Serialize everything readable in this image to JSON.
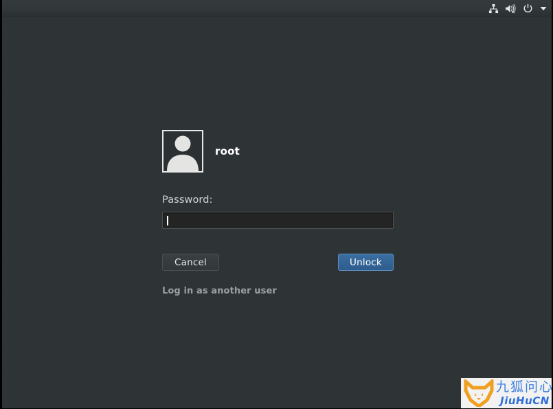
{
  "topbar": {
    "tray_items": [
      {
        "icon": "network-icon",
        "label": "Network"
      },
      {
        "icon": "volume-muted-icon",
        "label": "Volume muted"
      },
      {
        "icon": "power-icon",
        "label": "Power"
      },
      {
        "icon": "chevron-down-icon",
        "label": "System menu"
      }
    ]
  },
  "login": {
    "avatar_icon": "user-avatar-icon",
    "username": "root",
    "password_label": "Password:",
    "password_value": "",
    "password_placeholder": "",
    "cancel_label": "Cancel",
    "unlock_label": "Unlock",
    "other_user_label": "Log in as another user"
  },
  "watermark": {
    "logo_icon": "fox-logo-icon",
    "cn_text": "九狐问心",
    "en_text": "JiuHuCN"
  },
  "colors": {
    "background": "#2e3436",
    "panel": "#32383a",
    "accent_blue": "#2f5c8c",
    "accent_blue_border": "#5b8fc2",
    "text_primary": "#ffffff",
    "text_secondary": "#9aa0a0",
    "field_background": "#242424",
    "watermark_orange": "#f0a020",
    "watermark_blue": "#3d7fe0"
  }
}
